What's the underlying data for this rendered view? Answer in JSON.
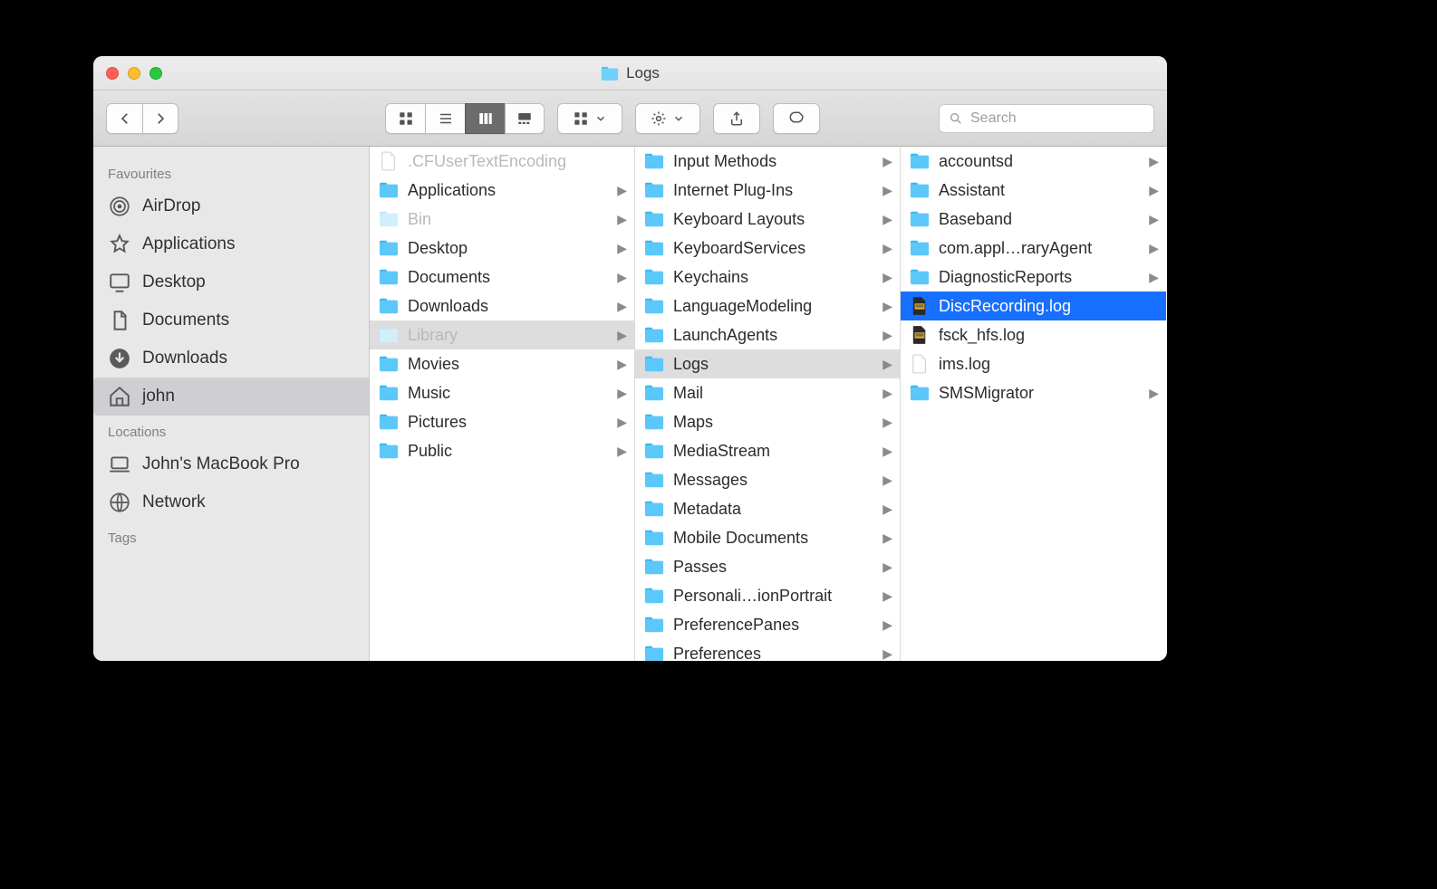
{
  "window": {
    "title": "Logs"
  },
  "toolbar": {
    "search_placeholder": "Search"
  },
  "sidebar": {
    "sections": [
      {
        "header": "Favourites",
        "items": [
          {
            "icon": "airdrop",
            "label": "AirDrop"
          },
          {
            "icon": "apps",
            "label": "Applications"
          },
          {
            "icon": "desktop",
            "label": "Desktop"
          },
          {
            "icon": "documents",
            "label": "Documents"
          },
          {
            "icon": "downloads",
            "label": "Downloads"
          },
          {
            "icon": "home",
            "label": "john",
            "selected": true
          }
        ]
      },
      {
        "header": "Locations",
        "items": [
          {
            "icon": "laptop",
            "label": "John's MacBook Pro"
          },
          {
            "icon": "network",
            "label": "Network"
          }
        ]
      },
      {
        "header": "Tags",
        "items": []
      }
    ]
  },
  "columns": [
    [
      {
        "kind": "file",
        "label": ".CFUserTextEncoding",
        "dim": true
      },
      {
        "kind": "folder",
        "label": "Applications",
        "children": true
      },
      {
        "kind": "folder",
        "label": "Bin",
        "children": true,
        "dim": true
      },
      {
        "kind": "folder",
        "label": "Desktop",
        "children": true
      },
      {
        "kind": "folder",
        "label": "Documents",
        "children": true
      },
      {
        "kind": "folder",
        "label": "Downloads",
        "children": true
      },
      {
        "kind": "folder",
        "label": "Library",
        "children": true,
        "dim": true,
        "pathSelected": true
      },
      {
        "kind": "folder",
        "label": "Movies",
        "children": true
      },
      {
        "kind": "folder",
        "label": "Music",
        "children": true
      },
      {
        "kind": "folder",
        "label": "Pictures",
        "children": true
      },
      {
        "kind": "folder",
        "label": "Public",
        "children": true
      }
    ],
    [
      {
        "kind": "folder",
        "label": "Input Methods",
        "children": true
      },
      {
        "kind": "folder",
        "label": "Internet Plug-Ins",
        "children": true
      },
      {
        "kind": "folder",
        "label": "Keyboard Layouts",
        "children": true
      },
      {
        "kind": "folder",
        "label": "KeyboardServices",
        "children": true
      },
      {
        "kind": "folder",
        "label": "Keychains",
        "children": true
      },
      {
        "kind": "folder",
        "label": "LanguageModeling",
        "children": true
      },
      {
        "kind": "folder",
        "label": "LaunchAgents",
        "children": true
      },
      {
        "kind": "folder",
        "label": "Logs",
        "children": true,
        "pathSelected": true
      },
      {
        "kind": "folder",
        "label": "Mail",
        "children": true
      },
      {
        "kind": "folder",
        "label": "Maps",
        "children": true
      },
      {
        "kind": "folder",
        "label": "MediaStream",
        "children": true
      },
      {
        "kind": "folder",
        "label": "Messages",
        "children": true
      },
      {
        "kind": "folder",
        "label": "Metadata",
        "children": true
      },
      {
        "kind": "folder",
        "label": "Mobile Documents",
        "children": true
      },
      {
        "kind": "folder",
        "label": "Passes",
        "children": true
      },
      {
        "kind": "folder",
        "label": "Personali…ionPortrait",
        "children": true
      },
      {
        "kind": "folder",
        "label": "PreferencePanes",
        "children": true
      },
      {
        "kind": "folder",
        "label": "Preferences",
        "children": true
      }
    ],
    [
      {
        "kind": "folder",
        "label": "accountsd",
        "children": true
      },
      {
        "kind": "folder",
        "label": "Assistant",
        "children": true
      },
      {
        "kind": "folder",
        "label": "Baseband",
        "children": true
      },
      {
        "kind": "folder",
        "label": "com.appl…raryAgent",
        "children": true
      },
      {
        "kind": "folder",
        "label": "DiagnosticReports",
        "children": true
      },
      {
        "kind": "log",
        "label": "DiscRecording.log",
        "selected": true
      },
      {
        "kind": "log",
        "label": "fsck_hfs.log"
      },
      {
        "kind": "file",
        "label": "ims.log"
      },
      {
        "kind": "folder",
        "label": "SMSMigrator",
        "children": true
      }
    ]
  ]
}
